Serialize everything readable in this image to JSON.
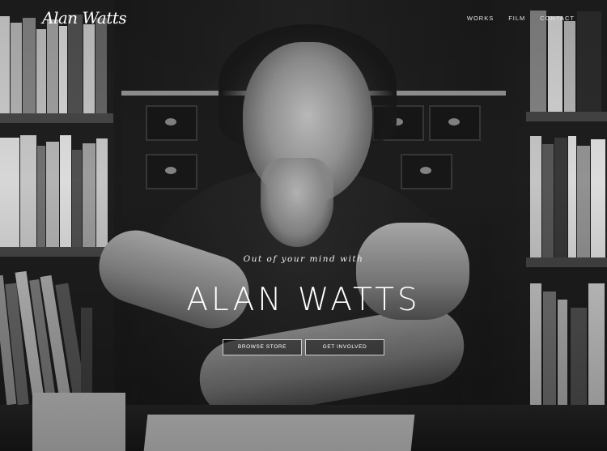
{
  "brand": {
    "logo_text": "Alan Watts"
  },
  "nav": {
    "items": [
      "WORKS",
      "FILM",
      "CONTACT"
    ]
  },
  "hero": {
    "tagline": "Out of your mind with",
    "title": "ALAN WATTS",
    "buttons": [
      "BROWSE STORE",
      "GET INVOLVED"
    ]
  },
  "colors": {
    "text": "#ffffff",
    "button_border": "#cfcfcf"
  }
}
